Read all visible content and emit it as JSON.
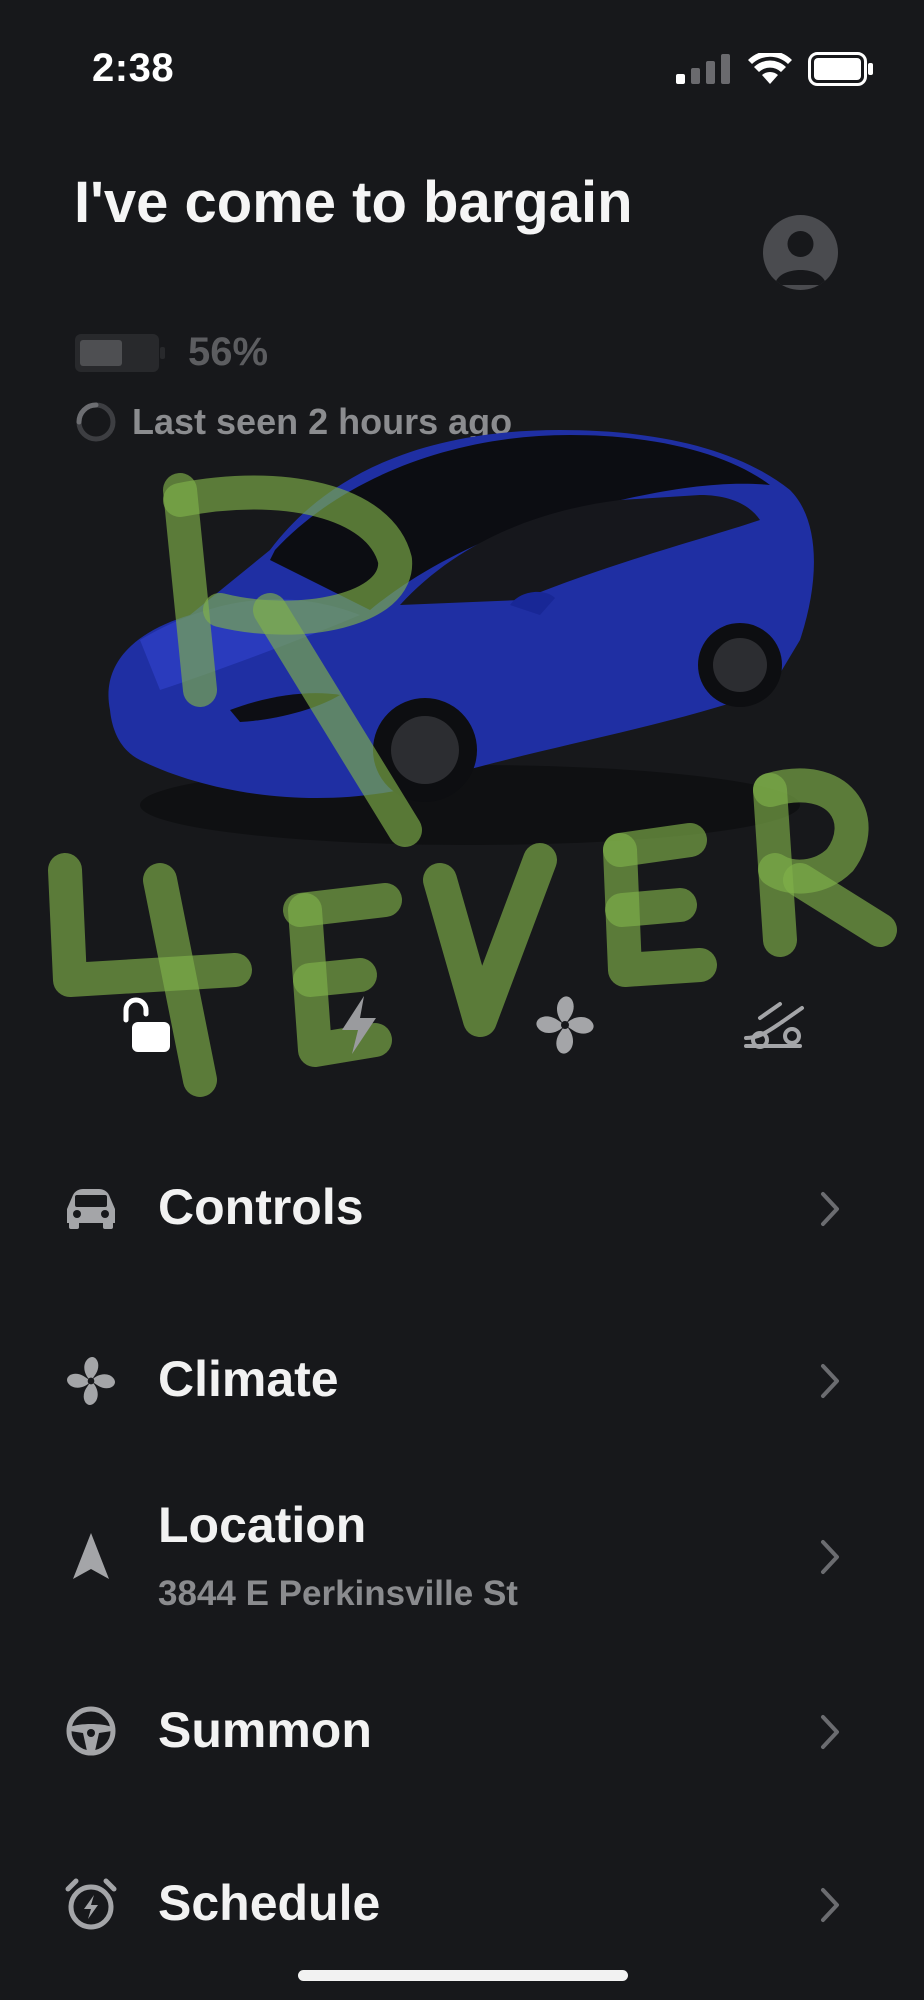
{
  "status_bar": {
    "time": "2:38"
  },
  "vehicle": {
    "name": "I've come to bargain",
    "battery_percent_label": "56%",
    "battery_level": 0.56,
    "last_seen": "Last seen 2 hours ago"
  },
  "graffiti_text": "R 4EVER",
  "quick_actions": [
    {
      "icon": "unlock-icon"
    },
    {
      "icon": "charge-bolt-icon"
    },
    {
      "icon": "fan-icon"
    },
    {
      "icon": "frunk-icon"
    }
  ],
  "menu": {
    "controls": {
      "label": "Controls"
    },
    "climate": {
      "label": "Climate"
    },
    "location": {
      "label": "Location",
      "subtitle": "3844 E Perkinsville St"
    },
    "summon": {
      "label": "Summon"
    },
    "schedule": {
      "label": "Schedule"
    }
  },
  "colors": {
    "background": "#17181b",
    "car_body": "#1f2fa3",
    "graffiti": "#7fb04a"
  }
}
